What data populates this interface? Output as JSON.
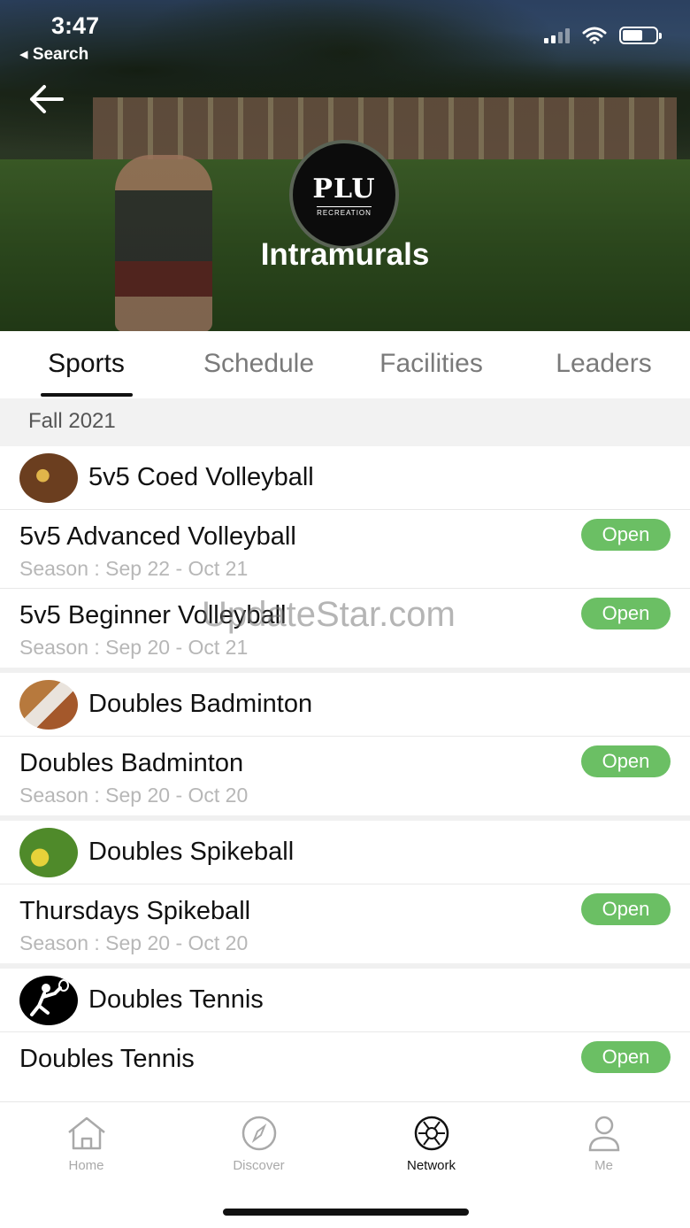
{
  "status": {
    "time": "3:47",
    "back_app": "◂ Search"
  },
  "hero": {
    "title": "Intramurals",
    "logo_text": "PLU",
    "logo_sub": "RECREATION"
  },
  "tabs": [
    {
      "label": "Sports",
      "active": true
    },
    {
      "label": "Schedule",
      "active": false
    },
    {
      "label": "Facilities",
      "active": false
    },
    {
      "label": "Leaders",
      "active": false
    }
  ],
  "season_header": "Fall 2021",
  "groups": [
    {
      "title": "5v5 Coed Volleyball",
      "icon": "volleyball-thumb",
      "rows": [
        {
          "name": "5v5 Advanced Volleyball",
          "season": "Season : Sep 22 - Oct 21",
          "status": "Open"
        },
        {
          "name": "5v5 Beginner Volleyball",
          "season": "Season : Sep 20 - Oct 21",
          "status": "Open"
        }
      ]
    },
    {
      "title": "Doubles Badminton",
      "icon": "badminton-thumb",
      "rows": [
        {
          "name": "Doubles Badminton",
          "season": "Season : Sep 20 - Oct 20",
          "status": "Open"
        }
      ]
    },
    {
      "title": "Doubles Spikeball",
      "icon": "spikeball-thumb",
      "rows": [
        {
          "name": "Thursdays Spikeball",
          "season": "Season : Sep 20 - Oct 20",
          "status": "Open"
        }
      ]
    },
    {
      "title": "Doubles Tennis",
      "icon": "tennis-icon",
      "rows": [
        {
          "name": "Doubles Tennis",
          "season": "",
          "status": "Open"
        }
      ]
    }
  ],
  "watermark": "UpdateStar.com",
  "nav": [
    {
      "label": "Home",
      "icon": "home-icon",
      "active": false
    },
    {
      "label": "Discover",
      "icon": "compass-icon",
      "active": false
    },
    {
      "label": "Network",
      "icon": "network-icon",
      "active": true
    },
    {
      "label": "Me",
      "icon": "person-icon",
      "active": false
    }
  ],
  "colors": {
    "open_badge": "#6bbf64",
    "season_header_bg": "#f2f2f2"
  }
}
